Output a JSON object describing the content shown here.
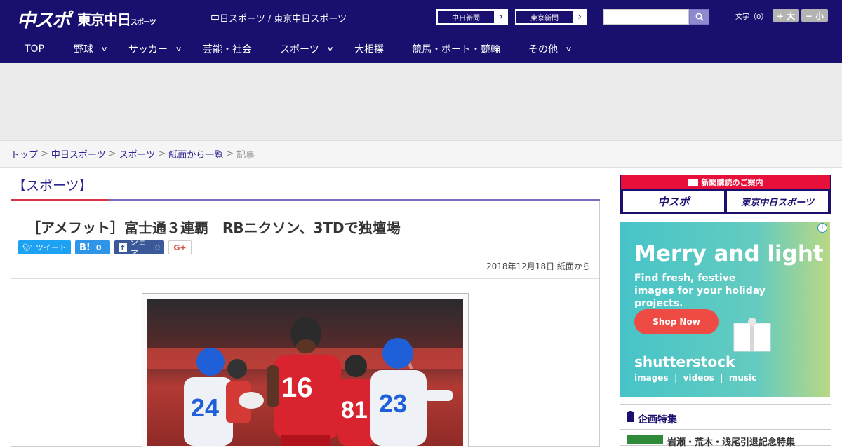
{
  "header": {
    "logo_primary": "中スポ",
    "logo_secondary": "東京中日",
    "logo_secondary_small": "スポーツ",
    "site_name": "中日スポーツ / 東京中日スポーツ",
    "paper_links": [
      "中日新聞",
      "東京新聞"
    ],
    "search": {
      "placeholder": ""
    },
    "font_size_label": "文字（0）",
    "font_larger": "+ 大",
    "font_smaller": "− 小"
  },
  "nav": {
    "items": [
      {
        "label": "TOP",
        "has_menu": false
      },
      {
        "label": "野球",
        "has_menu": true
      },
      {
        "label": "サッカー",
        "has_menu": true
      },
      {
        "label": "芸能・社会",
        "has_menu": false
      },
      {
        "label": "スポーツ",
        "has_menu": true
      },
      {
        "label": "大相撲",
        "has_menu": false
      },
      {
        "label": "競馬・ボート・競輪",
        "has_menu": false
      },
      {
        "label": "その他",
        "has_menu": true
      }
    ]
  },
  "breadcrumb": {
    "items": [
      "トップ",
      "中日スポーツ",
      "スポーツ",
      "紙面から一覧"
    ],
    "current": "記事"
  },
  "article": {
    "category": "【スポーツ】",
    "headline": "［アメフット］富士通３連覇　RBニクソン、3TDで独壇場",
    "date": "2018年12月18日 紙面から",
    "share": {
      "tweet": "ツイート",
      "hatena": "B!",
      "hatena_count": "0",
      "facebook": "シェア",
      "facebook_count": "0",
      "gplus": "G+"
    }
  },
  "sidebar": {
    "subscription_header": "新聞購読のご案内",
    "subscription_left": "中スポ",
    "subscription_right": "東京中日スポーツ",
    "ad": {
      "title": "Merry and light",
      "subtitle": "Find fresh, festive images for your holiday projects.",
      "cta": "Shop Now",
      "brand": "shutterstock",
      "links": "images  |  videos  |  music",
      "info": "i"
    },
    "feature_title": "企画特集",
    "feature_item": "岩瀬・荒木・浅尾引退記念特集"
  },
  "colors": {
    "brand_navy": "#180f6e",
    "accent_red": "#e6103a",
    "link": "#2a2590"
  }
}
